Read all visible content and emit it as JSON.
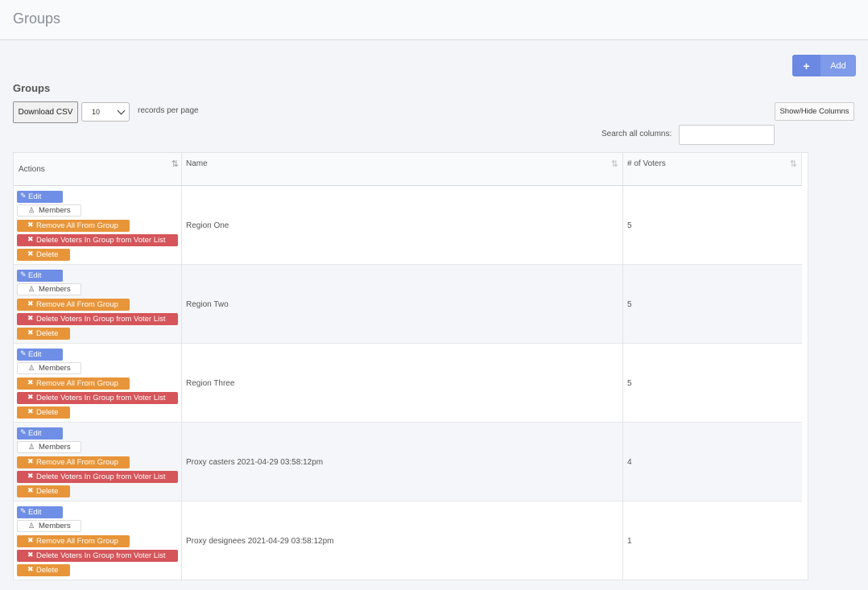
{
  "header": {
    "title": "Groups"
  },
  "toolbar": {
    "add_icon": "+",
    "add_label": "Add",
    "section_title": "Groups",
    "download_csv": "Download CSV",
    "per_page_value": "10",
    "per_page_label": "records per page",
    "show_hide_columns": "Show/Hide Columns",
    "search_label": "Search all columns:",
    "search_value": ""
  },
  "table": {
    "columns": [
      "Actions",
      "Name",
      "# of Voters"
    ],
    "sort_icons": [
      "⇅",
      "⇅",
      "⇅"
    ],
    "action_labels": {
      "edit": "Edit",
      "members": "Members",
      "remove_all": "Remove All From Group",
      "delete_voters": "Delete Voters In Group from Voter List",
      "delete": "Delete"
    },
    "action_icons": {
      "edit": "✎",
      "members": "♙",
      "remove_all": "✖",
      "delete_voters": "✖",
      "delete": "✖"
    },
    "rows": [
      {
        "name": "Region One",
        "voters": "5"
      },
      {
        "name": "Region Two",
        "voters": "5"
      },
      {
        "name": "Region Three",
        "voters": "5"
      },
      {
        "name": "Proxy casters 2021-04-29 03:58:12pm",
        "voters": "4"
      },
      {
        "name": "Proxy designees 2021-04-29 03:58:12pm",
        "voters": "1"
      }
    ]
  }
}
